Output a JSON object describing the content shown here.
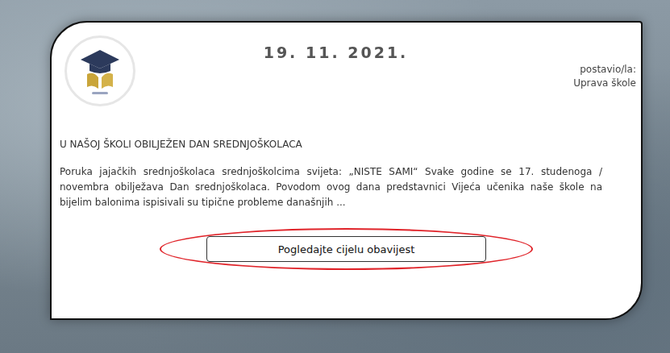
{
  "notice": {
    "date": "19. 11. 2021.",
    "author_label": "postavio/la:",
    "author": "Uprava škole",
    "title": "U NAŠOJ ŠKOLI OBILJEŽEN DAN SREDNJOŠKOLACA",
    "excerpt": "Poruka jajačkih srednjoškolaca srednjoškolcima svijeta: „NISTE SAMI“ Svake godine se 17. studenoga / novembra obilježava Dan srednjoškolaca. Povodom ovog dana predstavnici Vijeća učenika naše škole na bijelim balonima ispisivali su tipične probleme današnjih ...",
    "button": "Pogledajte cijelu obavijest"
  }
}
